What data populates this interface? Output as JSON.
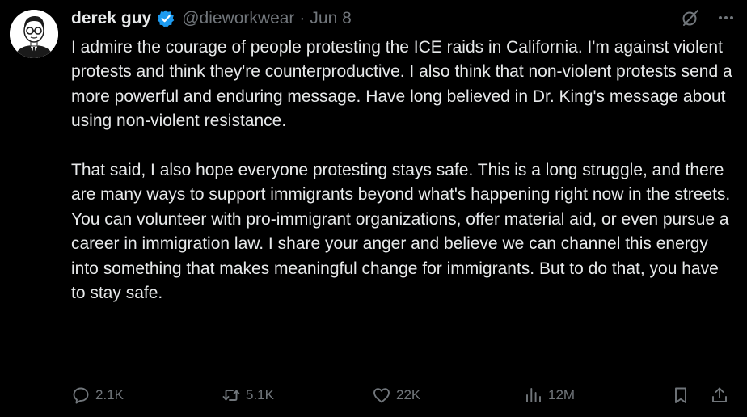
{
  "author": {
    "display_name": "derek guy",
    "handle": "@dieworkwear",
    "separator": "·",
    "date": "Jun 8",
    "verified": true
  },
  "tweet": {
    "paragraphs": [
      "I admire the courage of people protesting the ICE raids in California. I'm against violent protests and think they're counterproductive. I also think that non-violent protests send a more powerful and enduring message. Have long believed in Dr. King's message about using non-violent resistance.",
      "That said, I also hope everyone protesting stays safe. This is a long struggle, and there are many ways to support immigrants beyond what's happening right now in the streets. You can volunteer with pro-immigrant organizations, offer material aid, or even pursue a career in immigration law. I share your anger and believe we can channel this energy into something that makes meaningful change for immigrants. But to do that, you have to stay safe."
    ]
  },
  "metrics": {
    "replies": "2.1K",
    "reposts": "5.1K",
    "likes": "22K",
    "views": "12M"
  },
  "icons": {
    "verified": "verified-badge-icon",
    "grok": "grok-icon",
    "more": "more-options-icon",
    "reply": "reply-icon",
    "repost": "repost-icon",
    "like": "like-icon",
    "views": "views-icon",
    "bookmark": "bookmark-icon",
    "share": "share-icon"
  },
  "colors": {
    "background": "#000000",
    "text": "#e7e9ea",
    "secondary_text": "#71767b",
    "verified_blue": "#1d9bf0"
  }
}
